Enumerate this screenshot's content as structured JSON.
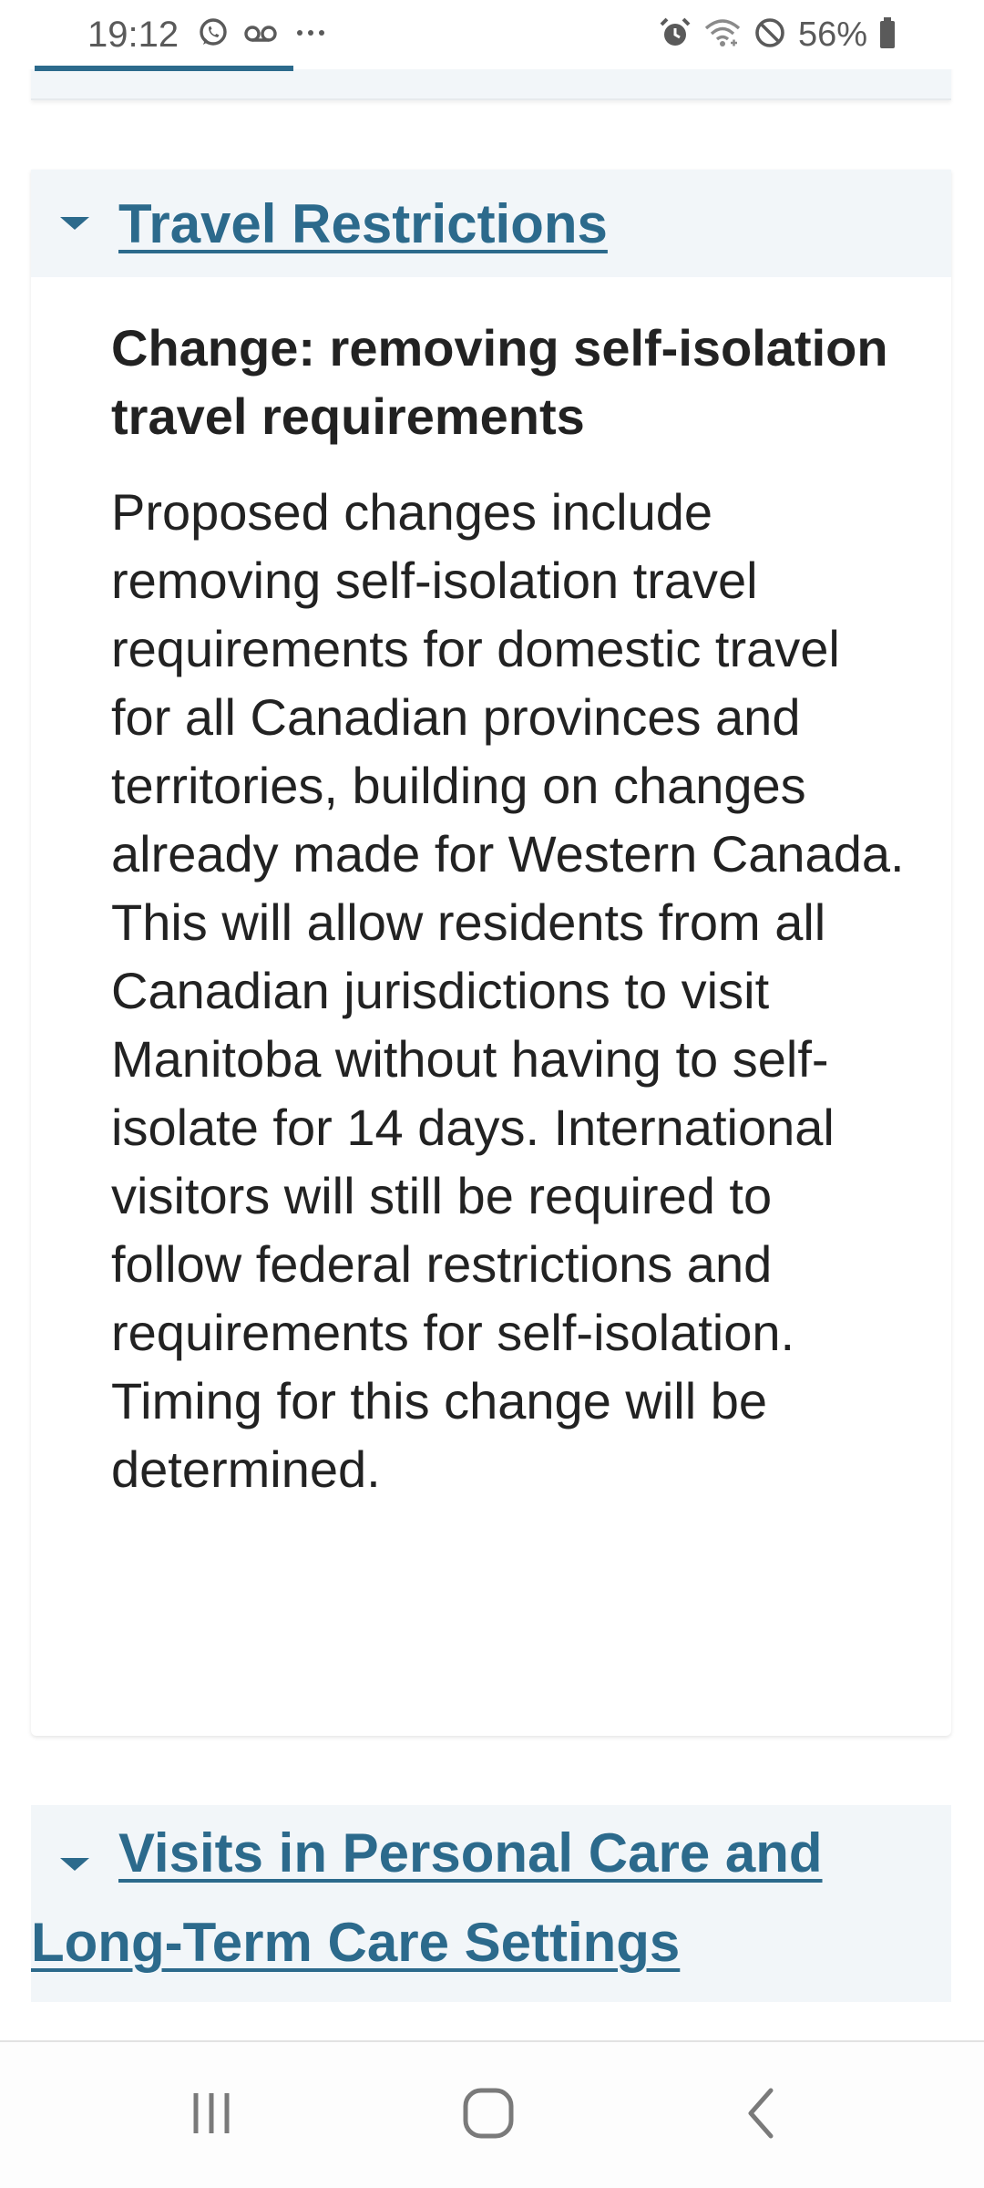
{
  "status_bar": {
    "time": "19:12",
    "battery": "56%",
    "left_icons": [
      "whatsapp-icon",
      "voicemail-icon",
      "more-dots-icon"
    ],
    "right_icons": [
      "alarm-icon",
      "wifi-icon",
      "do-not-disturb-icon",
      "battery-icon"
    ]
  },
  "sections": {
    "travel": {
      "title": "Travel Restrictions",
      "expanded": true,
      "heading": "Change: removing self-isolation travel requirements",
      "body": "Proposed changes include removing self-isolation travel requirements for domestic travel for all Canadian provinces and territories, building on changes already made for Western Canada. This will allow residents from all Canadian jurisdictions to visit Manitoba without having to self-isolate for 14 days. International visitors will still be required to follow federal restrictions and requirements for self-isolation. Timing for this change will be determined."
    },
    "visits": {
      "title": "Visits in Personal Care and Long-Term Care Settings",
      "expanded": true
    }
  },
  "nav_bar": {
    "buttons": [
      "recent-apps-icon",
      "home-icon",
      "back-icon"
    ]
  },
  "colors": {
    "link": "#2c6a8c",
    "header_bg": "#f2f6f9",
    "text": "#222222"
  }
}
